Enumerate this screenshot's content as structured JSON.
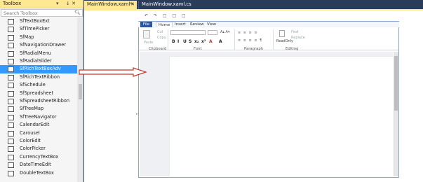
{
  "toolbox": {
    "title": "Toolbox",
    "pin_glyph": "↓ ✕",
    "dropdown_glyph": "▾",
    "search_placeholder": "Search Toolbox",
    "search_icon": "search-icon",
    "items": [
      {
        "label": "SfTextBoxExt",
        "icon": "textbox-icon"
      },
      {
        "label": "SfTimePicker",
        "icon": "timepicker-icon"
      },
      {
        "label": "SfMap",
        "icon": "map-pin-icon"
      },
      {
        "label": "SfNavigationDrawer",
        "icon": "drawer-icon"
      },
      {
        "label": "SfRadialMenu",
        "icon": "radial-menu-icon"
      },
      {
        "label": "SfRadialSlider",
        "icon": "radial-slider-icon"
      },
      {
        "label": "SfRichTextBoxAdv",
        "icon": "richtextbox-icon",
        "selected": true
      },
      {
        "label": "SfRichTextRibbon",
        "icon": "ribbon-icon"
      },
      {
        "label": "SfSchedule",
        "icon": "schedule-icon"
      },
      {
        "label": "SfSpreadsheet",
        "icon": "spreadsheet-icon"
      },
      {
        "label": "SfSpreadsheetRibbon",
        "icon": "spreadsheet-ribbon-icon"
      },
      {
        "label": "SfTreeMap",
        "icon": "treemap-icon"
      },
      {
        "label": "SfTreeNavigator",
        "icon": "treenavigator-icon"
      },
      {
        "label": "CalendarEdit",
        "icon": "calendar-icon"
      },
      {
        "label": "Carousel",
        "icon": "carousel-icon"
      },
      {
        "label": "ColorEdit",
        "icon": "coloredit-icon"
      },
      {
        "label": "ColorPicker",
        "icon": "colorpicker-icon"
      },
      {
        "label": "CurrencyTextBox",
        "icon": "currency-icon"
      },
      {
        "label": "DateTimeEdit",
        "icon": "datetime-icon"
      },
      {
        "label": "DoubleTextBox",
        "icon": "double-textbox-icon"
      }
    ]
  },
  "tabs": [
    {
      "label": "MainWindow.xaml*",
      "active": true,
      "close": "✕",
      "pin": "⊕"
    },
    {
      "label": "MainWindow.xaml.cs",
      "active": false
    }
  ],
  "ribbon": {
    "tabs": [
      "File",
      "Home",
      "Insert",
      "Review",
      "View"
    ],
    "groups": [
      "Clipboard",
      "Font",
      "Paragraph",
      "Editing"
    ],
    "paste_label": "Paste",
    "cut_label": "Cut",
    "copy_label": "Copy",
    "readonly_label": "ReadOnly",
    "find_label": "Find",
    "replace_label": "Replace",
    "format_buttons": [
      "B",
      "I",
      "U",
      "S",
      "x₂",
      "x²",
      "A",
      "A"
    ],
    "zoom_glyphs": "↶ ↷ □ □ □"
  },
  "colors": {
    "accent_tab": "#ffe893",
    "selection": "#3399ff",
    "ide_background": "#2b3b5a",
    "arrow": "#c0392b",
    "ribbon_file": "#2b579a"
  }
}
